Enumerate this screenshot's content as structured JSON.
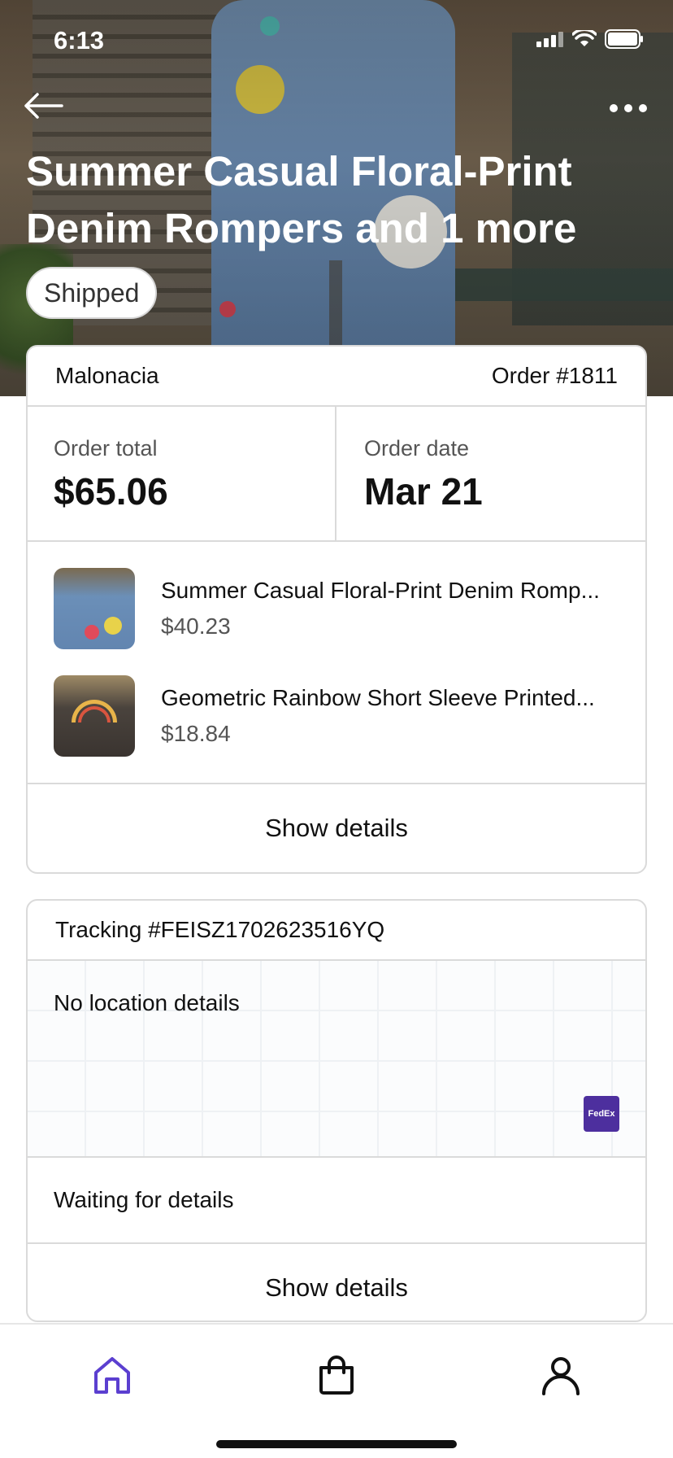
{
  "status_bar": {
    "time": "6:13"
  },
  "hero": {
    "title": "Summer Casual Floral-Print Denim Rompers and 1 more",
    "status_badge": "Shipped"
  },
  "order": {
    "shop": "Malonacia",
    "order_number": "Order #1811",
    "total_label": "Order total",
    "total_value": "$65.06",
    "date_label": "Order date",
    "date_value": "Mar 21",
    "items": [
      {
        "name": "Summer Casual Floral-Print Denim Romp...",
        "price": "$40.23"
      },
      {
        "name": "Geometric Rainbow Short Sleeve Printed...",
        "price": "$18.84"
      }
    ],
    "show_details_label": "Show details"
  },
  "tracking": {
    "tracking_number": "Tracking #FEISZ1702623516YQ",
    "map_text": "No location details",
    "carrier_logo_text": "FedEx",
    "status_text": "Waiting for details",
    "show_details_label": "Show details"
  },
  "bottom_nav": {
    "items": [
      {
        "icon": "home-icon",
        "active": true
      },
      {
        "icon": "shopping-bag-icon",
        "active": false
      },
      {
        "icon": "profile-icon",
        "active": false
      }
    ]
  },
  "colors": {
    "accent": "#5b3fd0",
    "border": "#dadada",
    "text_primary": "#111111",
    "text_secondary": "#555555"
  }
}
